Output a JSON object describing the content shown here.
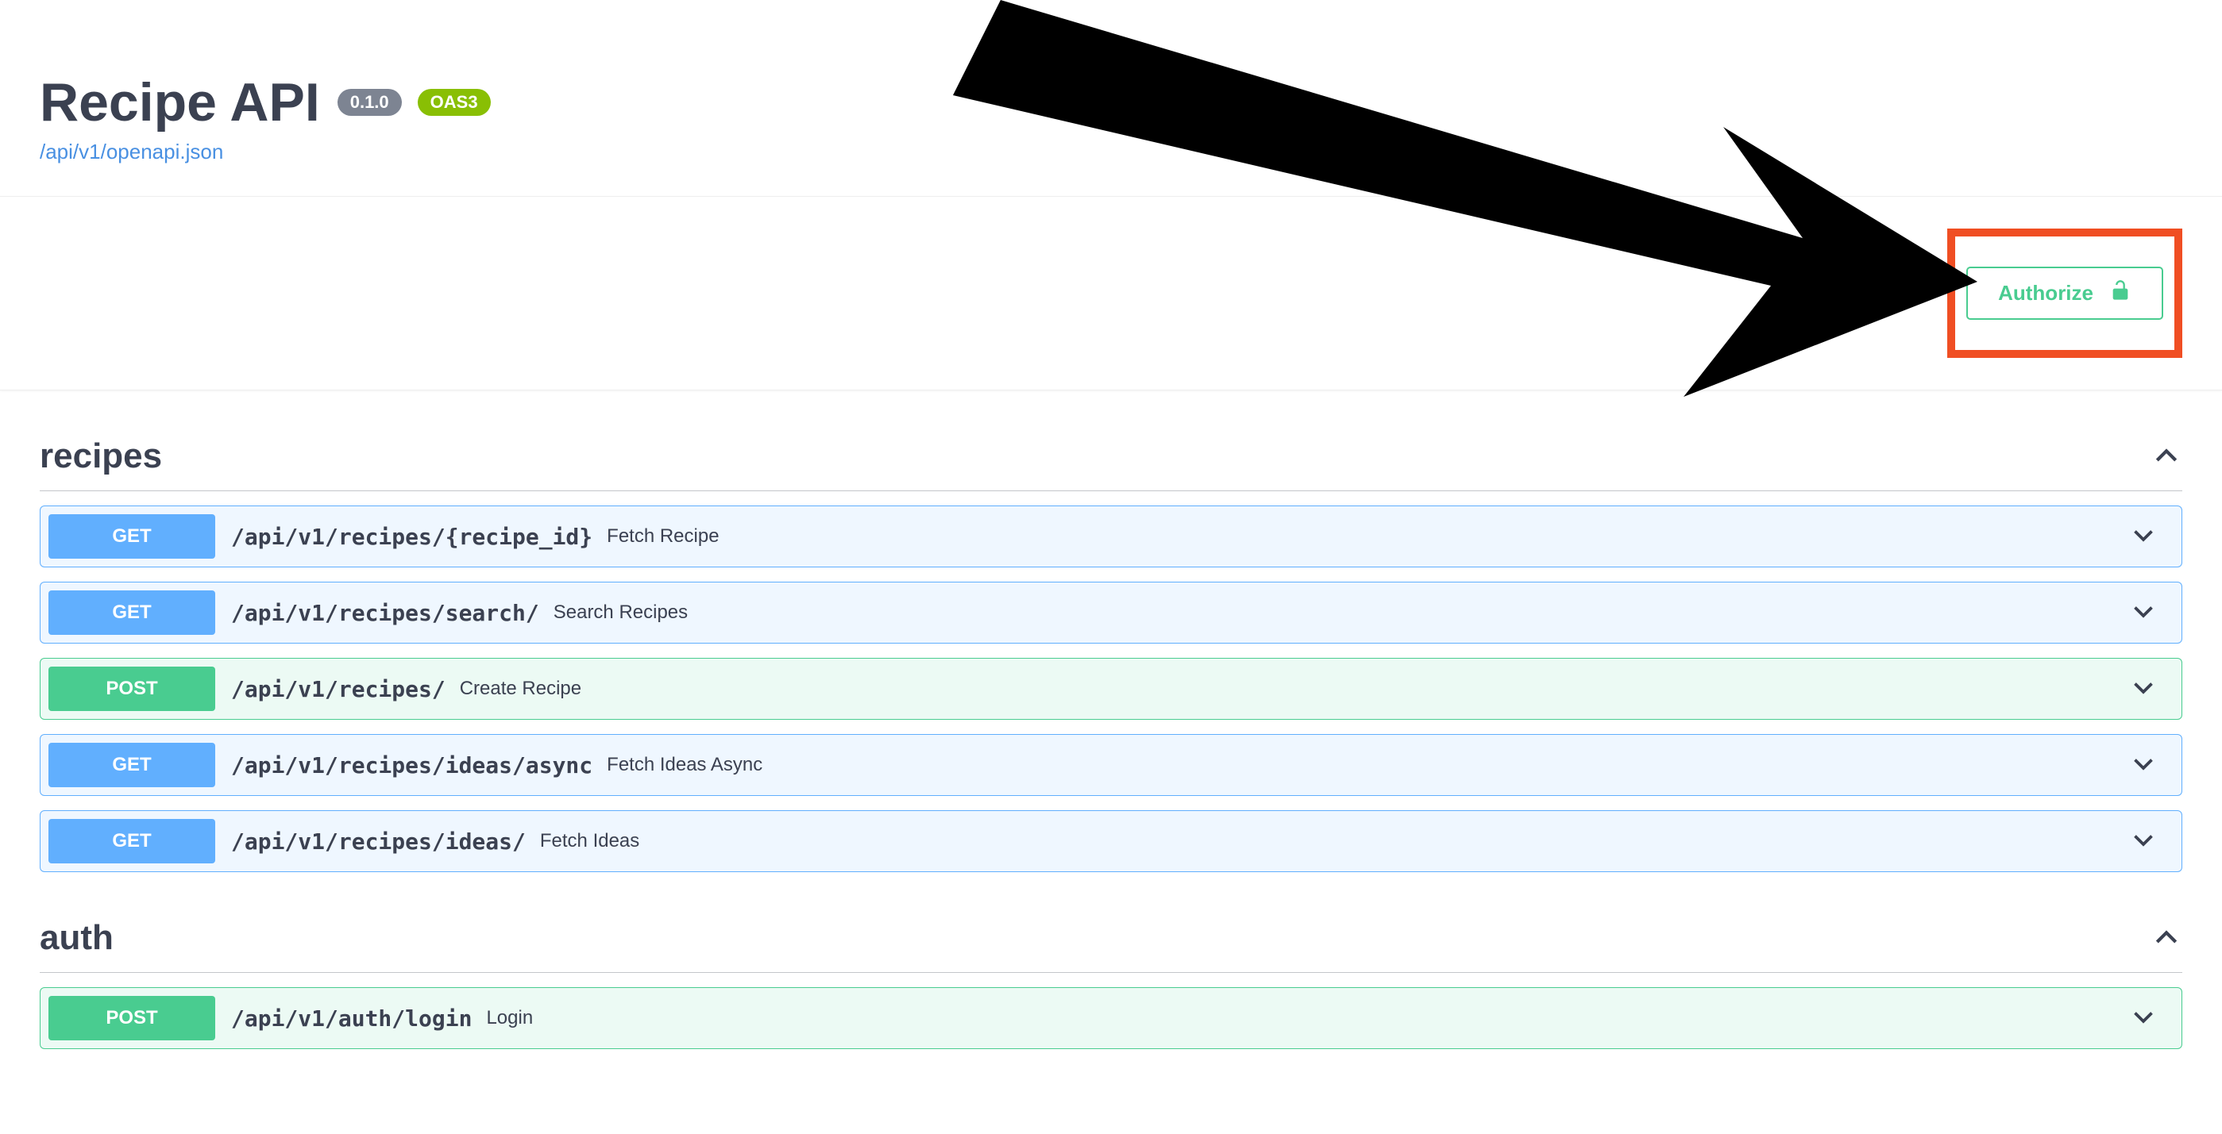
{
  "header": {
    "title": "Recipe API",
    "version": "0.1.0",
    "oas_label": "OAS3",
    "spec_link": "/api/v1/openapi.json"
  },
  "authorize": {
    "label": "Authorize"
  },
  "tags": [
    {
      "name": "recipes",
      "operations": [
        {
          "method": "GET",
          "path": "/api/v1/recipes/{recipe_id}",
          "summary": "Fetch Recipe"
        },
        {
          "method": "GET",
          "path": "/api/v1/recipes/search/",
          "summary": "Search Recipes"
        },
        {
          "method": "POST",
          "path": "/api/v1/recipes/",
          "summary": "Create Recipe"
        },
        {
          "method": "GET",
          "path": "/api/v1/recipes/ideas/async",
          "summary": "Fetch Ideas Async"
        },
        {
          "method": "GET",
          "path": "/api/v1/recipes/ideas/",
          "summary": "Fetch Ideas"
        }
      ]
    },
    {
      "name": "auth",
      "operations": [
        {
          "method": "POST",
          "path": "/api/v1/auth/login",
          "summary": "Login"
        }
      ]
    }
  ]
}
